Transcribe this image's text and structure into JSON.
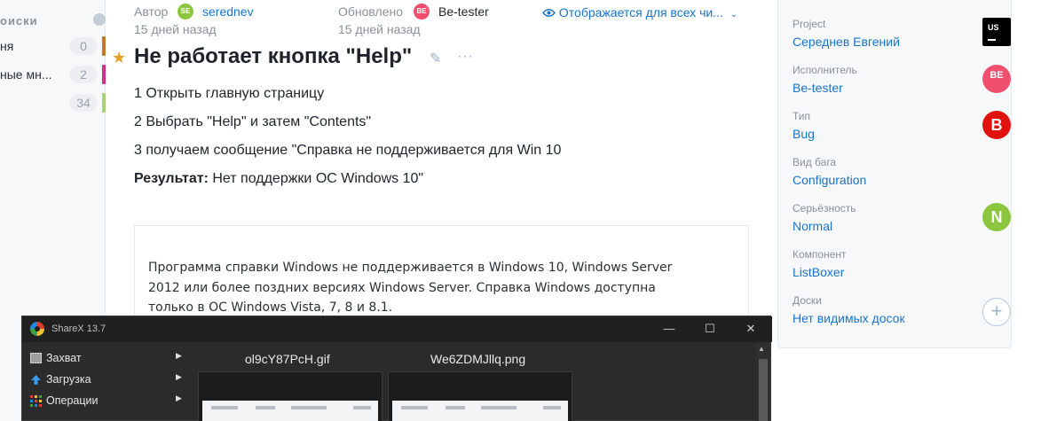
{
  "sidebar": {
    "header": "оиски",
    "items": [
      {
        "label": "ня",
        "count": "0",
        "bar_color": "#c07a2c"
      },
      {
        "label": "ные мн...",
        "count": "2",
        "bar_color": "#d0308a"
      },
      {
        "label": "",
        "count": "34",
        "bar_color": "#a6d27a"
      }
    ]
  },
  "issue": {
    "author_label": "Автор",
    "author_avatar": "SE",
    "author_name": "serednev",
    "author_time": "15 дней назад",
    "updated_label": "Обновлено",
    "updated_avatar": "BE",
    "updated_name": "Be-tester",
    "updated_time": "15 дней назад",
    "visibility": "Отображается для всех чи...",
    "title": "Не работает кнопка \"Help\"",
    "steps": [
      "1 Открыть главную страницу",
      "2 Выбрать \"Help\" и затем \"Contents\"",
      "3 получаем сообщение \"Справка не поддерживается для Win 10"
    ],
    "result_label": "Результат:",
    "result_text": " Нет поддержки ОС Windows 10\"",
    "quote_text": "Программа справки Windows не поддерживается в Windows 10, Windows Server 2012 или более поздних версиях Windows Server. Справка Windows доступна только в ОС Windows Vista, 7, 8 и 8.1."
  },
  "fields": [
    {
      "label": "Project",
      "value": "Середнев Евгений",
      "avatar": "US",
      "avatar_color": "#000000"
    },
    {
      "label": "Исполнитель",
      "value": "Be-tester",
      "avatar": "BE",
      "avatar_color": "#f0506e"
    },
    {
      "label": "Тип",
      "value": "Bug",
      "avatar": "B",
      "avatar_color": "#e0120e"
    },
    {
      "label": "Вид бага",
      "value": "Configuration",
      "avatar": "",
      "avatar_color": ""
    },
    {
      "label": "Серьёзность",
      "value": "Normal",
      "avatar": "N",
      "avatar_color": "#8cc63f"
    },
    {
      "label": "Компонент",
      "value": "ListBoxer",
      "avatar": "",
      "avatar_color": ""
    },
    {
      "label": "Доски",
      "value": "Нет видимых досок",
      "avatar": "+",
      "avatar_color": ""
    }
  ],
  "sharex": {
    "title": "ShareX 13.7",
    "controls": [
      "—",
      "☐",
      "✕"
    ],
    "menu": [
      {
        "label": "Захват",
        "icon": "monitor-icon"
      },
      {
        "label": "Загрузка",
        "icon": "upload-arrow-icon"
      },
      {
        "label": "Операции",
        "icon": "grid-tools-icon"
      }
    ],
    "files": [
      "ol9cY87PcH.gif",
      "We6ZDMJllq.png"
    ]
  },
  "colors": {
    "accent_link": "#1a73c7",
    "star": "#e4a028",
    "sharex_bg": "#2b2b2b"
  }
}
